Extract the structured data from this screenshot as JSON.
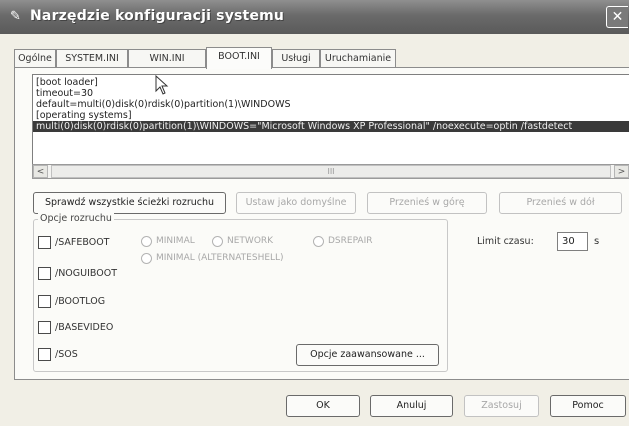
{
  "window": {
    "title": "Narzędzie konfiguracji systemu",
    "close_glyph": "✕"
  },
  "tabs": [
    {
      "label": "Ogólne"
    },
    {
      "label": "SYSTEM.INI"
    },
    {
      "label": "WIN.INI"
    },
    {
      "label": "BOOT.INI",
      "active": true
    },
    {
      "label": "Usługi"
    },
    {
      "label": "Uruchamianie"
    }
  ],
  "bootini": {
    "lines": [
      "[boot loader]",
      "timeout=30",
      "default=multi(0)disk(0)rdisk(0)partition(1)\\WINDOWS",
      "[operating systems]",
      "multi(0)disk(0)rdisk(0)partition(1)\\WINDOWS=\"Microsoft Windows XP Professional\" /noexecute=optin /fastdetect"
    ],
    "selected_index": 4
  },
  "scroll": {
    "left": "<",
    "right": ">",
    "grip": "III"
  },
  "buttons": {
    "check_paths": "Sprawdź wszystkie ścieżki rozruchu",
    "set_default": "Ustaw jako domyślne",
    "move_up": "Przenieś w górę",
    "move_down": "Przenieś w dół",
    "advanced": "Opcje zaawansowane ...",
    "ok": "OK",
    "cancel": "Anuluj",
    "apply": "Zastosuj",
    "help": "Pomoc"
  },
  "boot_options": {
    "label": "Opcje rozruchu",
    "checkboxes": [
      {
        "label": "/SAFEBOOT",
        "checked": false
      },
      {
        "label": "/NOGUIBOOT",
        "checked": false
      },
      {
        "label": "/BOOTLOG",
        "checked": false
      },
      {
        "label": "/BASEVIDEO",
        "checked": false
      },
      {
        "label": "/SOS",
        "checked": false
      }
    ],
    "radios": [
      {
        "label": "MINIMAL",
        "enabled": false
      },
      {
        "label": "NETWORK",
        "enabled": false
      },
      {
        "label": "DSREPAIR",
        "enabled": false
      },
      {
        "label": "MINIMAL (ALTERNATESHELL)",
        "enabled": false
      }
    ]
  },
  "timeout": {
    "label": "Limit czasu:",
    "value": "30",
    "unit": "s"
  }
}
